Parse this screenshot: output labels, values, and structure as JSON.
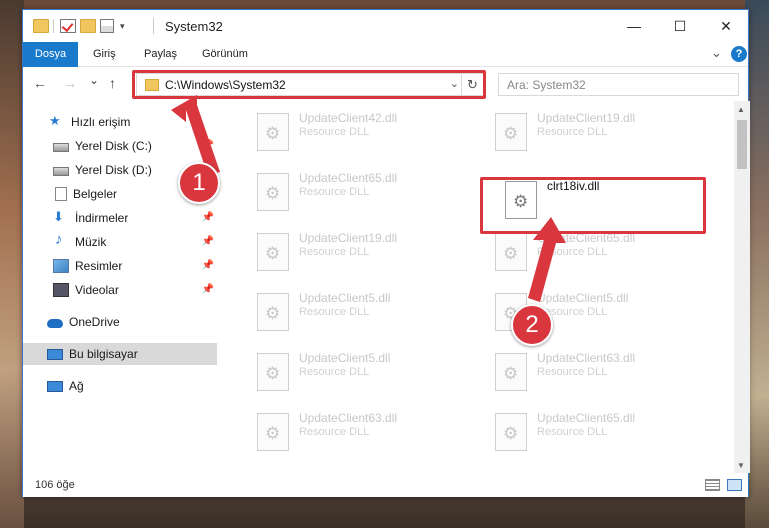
{
  "window": {
    "title": "System32",
    "controls": {
      "minimize": "—",
      "maximize": "☐",
      "close": "✕"
    }
  },
  "ribbon": {
    "tabs": [
      "Dosya",
      "Giriş",
      "Paylaş",
      "Görünüm"
    ],
    "expand_glyph": "⌄",
    "help": "?"
  },
  "nav": {
    "back": "←",
    "forward": "→",
    "recent": "⌄",
    "up": "↑",
    "address": "C:\\Windows\\System32",
    "address_dropdown": "⌄",
    "refresh": "↻",
    "search_placeholder": "Ara: System32"
  },
  "sidebar": {
    "items": [
      {
        "label": "Hızlı erişim",
        "icon": "star-icon"
      },
      {
        "label": "Yerel Disk (C:)",
        "icon": "disk-icon",
        "pinned": true
      },
      {
        "label": "Yerel Disk (D:)",
        "icon": "disk-icon",
        "pinned": true
      },
      {
        "label": "Belgeler",
        "icon": "document-icon",
        "pinned": true
      },
      {
        "label": "İndirmeler",
        "icon": "download-icon",
        "pinned": true
      },
      {
        "label": "Müzik",
        "icon": "music-icon",
        "pinned": true
      },
      {
        "label": "Resimler",
        "icon": "pictures-icon",
        "pinned": true
      },
      {
        "label": "Videolar",
        "icon": "video-icon",
        "pinned": true
      },
      {
        "label": "OneDrive",
        "icon": "cloud-icon"
      },
      {
        "label": "Bu bilgisayar",
        "icon": "computer-icon",
        "selected": true
      },
      {
        "label": "Ağ",
        "icon": "network-icon"
      }
    ],
    "pin_glyph": "📌"
  },
  "files": {
    "left": [
      {
        "name": "UpdateClient42.dll",
        "desc": "Resource DLL"
      },
      {
        "name": "UpdateClient65.dll",
        "desc": "Resource DLL"
      },
      {
        "name": "UpdateClient19.dll",
        "desc": "Resource DLL"
      },
      {
        "name": "UpdateClient5.dll",
        "desc": "Resource DLL"
      },
      {
        "name": "UpdateClient5.dll",
        "desc": "Resource DLL"
      },
      {
        "name": "UpdateClient63.dll",
        "desc": "Resource DLL"
      }
    ],
    "right": [
      {
        "name": "UpdateClient19.dll",
        "desc": "Resource DLL"
      },
      {
        "name": "clrt18iv.dll",
        "desc": ""
      },
      {
        "name": "UpdateClient65.dll",
        "desc": "Resource DLL"
      },
      {
        "name": "UpdateClient5.dll",
        "desc": "Resource DLL"
      },
      {
        "name": "UpdateClient63.dll",
        "desc": "Resource DLL"
      },
      {
        "name": "UpdateClient65.dll",
        "desc": "Resource DLL"
      }
    ]
  },
  "status": {
    "count": "106 öğe"
  },
  "annotations": {
    "step1": "1",
    "step2": "2"
  },
  "colors": {
    "accent": "#1979ca",
    "highlight": "#d9363e",
    "selected": "#d9d9d9"
  }
}
